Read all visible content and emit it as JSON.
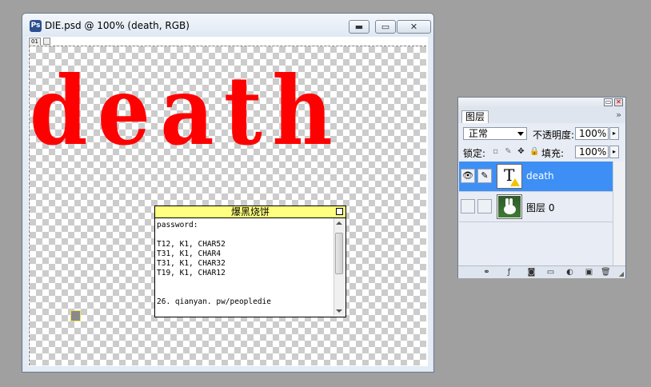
{
  "document": {
    "title": "DIE.psd @ 100% (death, RGB)",
    "ruler_tag": "01",
    "canvas_text": "death",
    "text_color": "#ff0000"
  },
  "note": {
    "title": "爆黑烧饼",
    "lines": [
      "password:",
      "",
      "T12, K1, CHAR52",
      "T31, K1, CHAR4",
      "T31, K1, CHAR32",
      "T19, K1, CHAR12",
      "",
      "",
      "26. qianyan. pw/peopledie"
    ]
  },
  "layers_panel": {
    "tab": "图层",
    "blend_mode": "正常",
    "opacity_label": "不透明度:",
    "opacity_value": "100%",
    "lock_label": "锁定:",
    "fill_label": "填充:",
    "fill_value": "100%",
    "layers": [
      {
        "name": "death",
        "type": "text",
        "selected": true,
        "visible": true
      },
      {
        "name": "图层 0",
        "type": "image",
        "selected": false,
        "visible": false
      }
    ],
    "selection_color": "#3d8ff5"
  }
}
